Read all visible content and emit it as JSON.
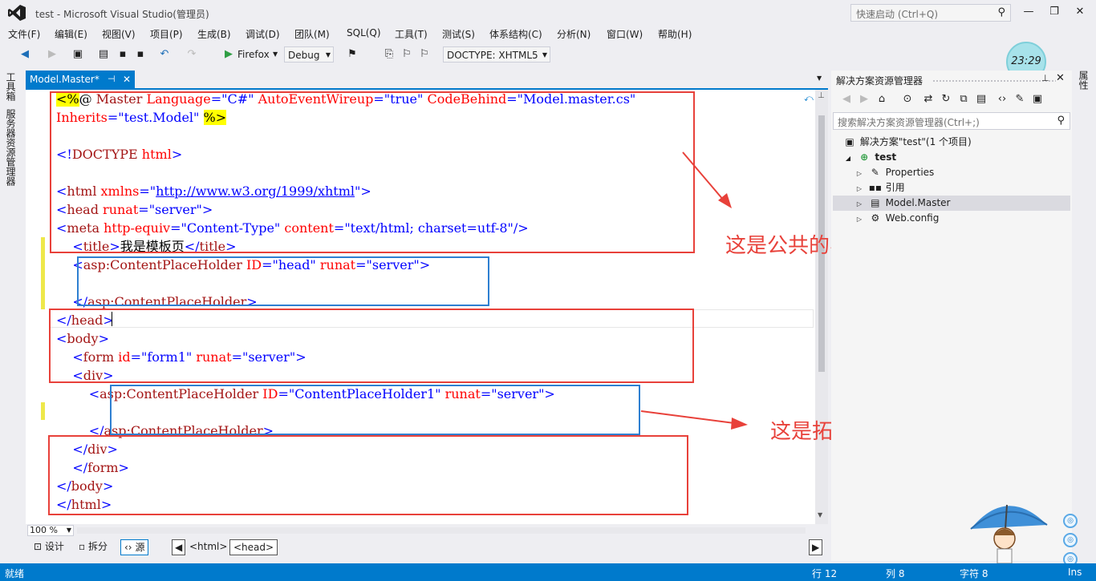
{
  "window": {
    "title": "test - Microsoft Visual Studio(管理员)",
    "quick_launch_placeholder": "快速启动 (Ctrl+Q)",
    "controls": [
      "—",
      "❐",
      "✕"
    ]
  },
  "menu": [
    "文件(F)",
    "编辑(E)",
    "视图(V)",
    "项目(P)",
    "生成(B)",
    "调试(D)",
    "团队(M)",
    "SQL(Q)",
    "工具(T)",
    "测试(S)",
    "体系结构(C)",
    "分析(N)",
    "窗口(W)",
    "帮助(H)"
  ],
  "toolbar": {
    "browser": "Firefox",
    "config": "Debug",
    "doctype": "DOCTYPE: XHTML5"
  },
  "clock": "23:29",
  "left_tabs": [
    "工具箱",
    "服务器资源管理器"
  ],
  "right_tab": "属性",
  "document_tab": {
    "label": "Model.Master*",
    "pin": "⊣",
    "close": "✕"
  },
  "editor": {
    "lines": [
      [
        [
          "t-y",
          "<%"
        ],
        [
          "t-black",
          "@ "
        ],
        [
          "t-darkred",
          "Master "
        ],
        [
          "t-red",
          "Language"
        ],
        [
          "t-val",
          "=\"C#\" "
        ],
        [
          "t-red",
          "AutoEventWireup"
        ],
        [
          "t-val",
          "=\"true\" "
        ],
        [
          "t-red",
          "CodeBehind"
        ],
        [
          "t-val",
          "=\"Model.master.cs\""
        ]
      ],
      [
        [
          "t-red",
          "Inherits"
        ],
        [
          "t-val",
          "=\"test.Model\" "
        ],
        [
          "t-y",
          "%>"
        ]
      ],
      [],
      [
        [
          "t-blue",
          "<!"
        ],
        [
          "t-darkred",
          "DOCTYPE "
        ],
        [
          "t-red",
          "html"
        ],
        [
          "t-blue",
          ">"
        ]
      ],
      [],
      [
        [
          "t-blue",
          "<"
        ],
        [
          "t-darkred",
          "html "
        ],
        [
          "t-red",
          "xmlns"
        ],
        [
          "t-blue",
          "=\""
        ],
        [
          "t-link",
          "http://www.w3.org/1999/xhtml"
        ],
        [
          "t-blue",
          "\">"
        ]
      ],
      [
        [
          "t-blue",
          "<"
        ],
        [
          "t-darkred",
          "head "
        ],
        [
          "t-red",
          "runat"
        ],
        [
          "t-blue",
          "=\"server\">"
        ]
      ],
      [
        [
          "t-blue",
          "<"
        ],
        [
          "t-darkred",
          "meta "
        ],
        [
          "t-red",
          "http-equiv"
        ],
        [
          "t-blue",
          "=\"Content-Type\" "
        ],
        [
          "t-red",
          "content"
        ],
        [
          "t-blue",
          "=\"text/html; charset=utf-8\"/>"
        ]
      ],
      [
        [
          "t-black",
          "    "
        ],
        [
          "t-blue",
          "<"
        ],
        [
          "t-darkred",
          "title"
        ],
        [
          "t-blue",
          ">"
        ],
        [
          "t-black",
          "我是模板页"
        ],
        [
          "t-blue",
          "</"
        ],
        [
          "t-darkred",
          "title"
        ],
        [
          "t-blue",
          ">"
        ]
      ],
      [
        [
          "t-black",
          "    "
        ],
        [
          "t-blue",
          "<"
        ],
        [
          "t-darkred",
          "asp:ContentPlaceHolder "
        ],
        [
          "t-red",
          "ID"
        ],
        [
          "t-blue",
          "=\"head\" "
        ],
        [
          "t-red",
          "runat"
        ],
        [
          "t-blue",
          "=\"server\">"
        ]
      ],
      [],
      [
        [
          "t-black",
          "    "
        ],
        [
          "t-blue",
          "</"
        ],
        [
          "t-darkred",
          "asp:ContentPlaceHolder"
        ],
        [
          "t-blue",
          ">"
        ]
      ],
      [
        [
          "t-blue",
          "</"
        ],
        [
          "t-darkred",
          "head"
        ],
        [
          "t-blue",
          ">"
        ]
      ],
      [
        [
          "t-blue",
          "<"
        ],
        [
          "t-darkred",
          "body"
        ],
        [
          "t-blue",
          ">"
        ]
      ],
      [
        [
          "t-black",
          "    "
        ],
        [
          "t-blue",
          "<"
        ],
        [
          "t-darkred",
          "form "
        ],
        [
          "t-red",
          "id"
        ],
        [
          "t-blue",
          "=\"form1\" "
        ],
        [
          "t-red",
          "runat"
        ],
        [
          "t-blue",
          "=\"server\">"
        ]
      ],
      [
        [
          "t-black",
          "    "
        ],
        [
          "t-blue",
          "<"
        ],
        [
          "t-darkred",
          "div"
        ],
        [
          "t-blue",
          ">"
        ]
      ],
      [
        [
          "t-black",
          "        "
        ],
        [
          "t-blue",
          "<"
        ],
        [
          "t-darkred",
          "asp:ContentPlaceHolder "
        ],
        [
          "t-red",
          "ID"
        ],
        [
          "t-blue",
          "=\"ContentPlaceHolder1\" "
        ],
        [
          "t-red",
          "runat"
        ],
        [
          "t-blue",
          "=\"server\">"
        ]
      ],
      [],
      [
        [
          "t-black",
          "        "
        ],
        [
          "t-blue",
          "</"
        ],
        [
          "t-darkred",
          "asp:ContentPlaceHolder"
        ],
        [
          "t-blue",
          ">"
        ]
      ],
      [
        [
          "t-black",
          "    "
        ],
        [
          "t-blue",
          "</"
        ],
        [
          "t-darkred",
          "div"
        ],
        [
          "t-blue",
          ">"
        ]
      ],
      [
        [
          "t-black",
          "    "
        ],
        [
          "t-blue",
          "</"
        ],
        [
          "t-darkred",
          "form"
        ],
        [
          "t-blue",
          ">"
        ]
      ],
      [
        [
          "t-blue",
          "</"
        ],
        [
          "t-darkred",
          "body"
        ],
        [
          "t-blue",
          ">"
        ]
      ],
      [
        [
          "t-blue",
          "</"
        ],
        [
          "t-darkred",
          "html"
        ],
        [
          "t-blue",
          ">"
        ]
      ]
    ],
    "zoom": "100 %"
  },
  "annotations": {
    "common": "这是公共的界面",
    "extension": "这是拓展的界面代码",
    "red": "#e8413a",
    "blue": "#2e7fd1"
  },
  "view_bar": {
    "design": "设计",
    "split": "拆分",
    "source": "源",
    "crumbs": [
      "<html>",
      "<head>"
    ]
  },
  "solution_explorer": {
    "title": "解决方案资源管理器",
    "search_placeholder": "搜索解决方案资源管理器(Ctrl+;)",
    "tree": [
      {
        "label": "解决方案\"test\"(1 个项目)",
        "icon": "solution-icon"
      },
      {
        "label": "test",
        "icon": "project-icon",
        "bold": true
      },
      {
        "label": "Properties",
        "icon": "wrench-icon"
      },
      {
        "label": "引用",
        "icon": "references-icon"
      },
      {
        "label": "Model.Master",
        "icon": "master-page-icon",
        "selected": true
      },
      {
        "label": "Web.config",
        "icon": "config-icon"
      }
    ]
  },
  "status": {
    "ready": "就绪",
    "line": "行 12",
    "col": "列 8",
    "char": "字符 8",
    "mode": "Ins"
  }
}
